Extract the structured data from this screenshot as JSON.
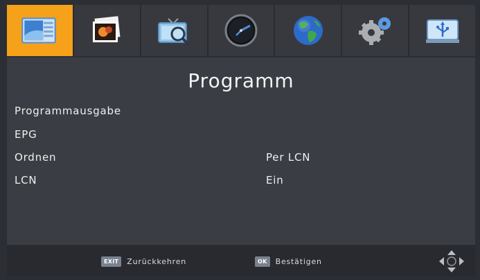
{
  "menu": {
    "tabs": [
      {
        "icon": "program-list-icon",
        "active": true
      },
      {
        "icon": "pictures-icon",
        "active": false
      },
      {
        "icon": "channel-search-icon",
        "active": false
      },
      {
        "icon": "clock-icon",
        "active": false
      },
      {
        "icon": "globe-icon",
        "active": false
      },
      {
        "icon": "gears-icon",
        "active": false
      },
      {
        "icon": "usb-icon",
        "active": false
      }
    ],
    "accent_color": "#f5a11a"
  },
  "panel": {
    "title": "Programm",
    "rows": [
      {
        "label": "Programmausgabe",
        "value": ""
      },
      {
        "label": "EPG",
        "value": ""
      },
      {
        "label": "Ordnen",
        "value": "Per LCN"
      },
      {
        "label": "LCN",
        "value": "Ein"
      }
    ]
  },
  "footer": {
    "back": {
      "key": "EXIT",
      "label": "Zurückkehren"
    },
    "confirm": {
      "key": "OK",
      "label": "Bestätigen"
    },
    "nav_icon": "navigation-arrows-icon"
  }
}
